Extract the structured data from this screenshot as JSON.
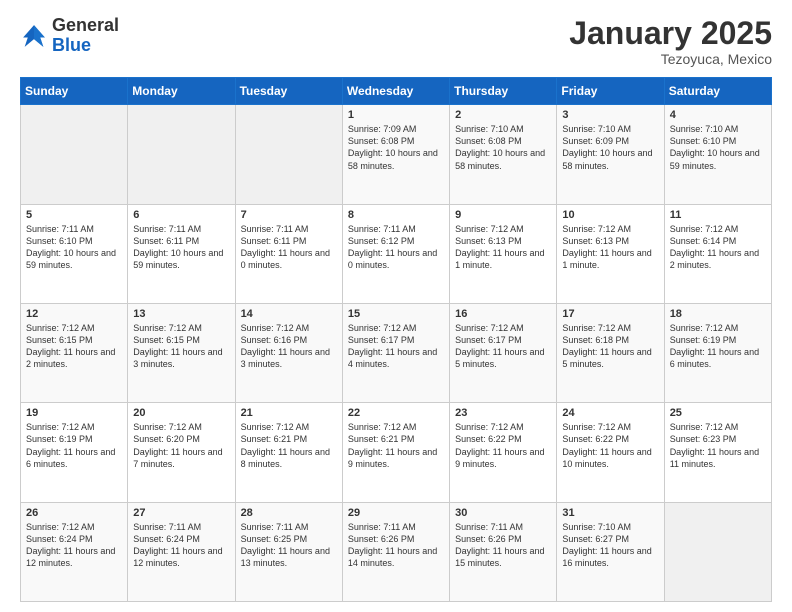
{
  "header": {
    "logo_general": "General",
    "logo_blue": "Blue",
    "month_title": "January 2025",
    "subtitle": "Tezoyuca, Mexico"
  },
  "days_of_week": [
    "Sunday",
    "Monday",
    "Tuesday",
    "Wednesday",
    "Thursday",
    "Friday",
    "Saturday"
  ],
  "weeks": [
    [
      {
        "day": "",
        "info": ""
      },
      {
        "day": "",
        "info": ""
      },
      {
        "day": "",
        "info": ""
      },
      {
        "day": "1",
        "info": "Sunrise: 7:09 AM\nSunset: 6:08 PM\nDaylight: 10 hours and 58 minutes."
      },
      {
        "day": "2",
        "info": "Sunrise: 7:10 AM\nSunset: 6:08 PM\nDaylight: 10 hours and 58 minutes."
      },
      {
        "day": "3",
        "info": "Sunrise: 7:10 AM\nSunset: 6:09 PM\nDaylight: 10 hours and 58 minutes."
      },
      {
        "day": "4",
        "info": "Sunrise: 7:10 AM\nSunset: 6:10 PM\nDaylight: 10 hours and 59 minutes."
      }
    ],
    [
      {
        "day": "5",
        "info": "Sunrise: 7:11 AM\nSunset: 6:10 PM\nDaylight: 10 hours and 59 minutes."
      },
      {
        "day": "6",
        "info": "Sunrise: 7:11 AM\nSunset: 6:11 PM\nDaylight: 10 hours and 59 minutes."
      },
      {
        "day": "7",
        "info": "Sunrise: 7:11 AM\nSunset: 6:11 PM\nDaylight: 11 hours and 0 minutes."
      },
      {
        "day": "8",
        "info": "Sunrise: 7:11 AM\nSunset: 6:12 PM\nDaylight: 11 hours and 0 minutes."
      },
      {
        "day": "9",
        "info": "Sunrise: 7:12 AM\nSunset: 6:13 PM\nDaylight: 11 hours and 1 minute."
      },
      {
        "day": "10",
        "info": "Sunrise: 7:12 AM\nSunset: 6:13 PM\nDaylight: 11 hours and 1 minute."
      },
      {
        "day": "11",
        "info": "Sunrise: 7:12 AM\nSunset: 6:14 PM\nDaylight: 11 hours and 2 minutes."
      }
    ],
    [
      {
        "day": "12",
        "info": "Sunrise: 7:12 AM\nSunset: 6:15 PM\nDaylight: 11 hours and 2 minutes."
      },
      {
        "day": "13",
        "info": "Sunrise: 7:12 AM\nSunset: 6:15 PM\nDaylight: 11 hours and 3 minutes."
      },
      {
        "day": "14",
        "info": "Sunrise: 7:12 AM\nSunset: 6:16 PM\nDaylight: 11 hours and 3 minutes."
      },
      {
        "day": "15",
        "info": "Sunrise: 7:12 AM\nSunset: 6:17 PM\nDaylight: 11 hours and 4 minutes."
      },
      {
        "day": "16",
        "info": "Sunrise: 7:12 AM\nSunset: 6:17 PM\nDaylight: 11 hours and 5 minutes."
      },
      {
        "day": "17",
        "info": "Sunrise: 7:12 AM\nSunset: 6:18 PM\nDaylight: 11 hours and 5 minutes."
      },
      {
        "day": "18",
        "info": "Sunrise: 7:12 AM\nSunset: 6:19 PM\nDaylight: 11 hours and 6 minutes."
      }
    ],
    [
      {
        "day": "19",
        "info": "Sunrise: 7:12 AM\nSunset: 6:19 PM\nDaylight: 11 hours and 6 minutes."
      },
      {
        "day": "20",
        "info": "Sunrise: 7:12 AM\nSunset: 6:20 PM\nDaylight: 11 hours and 7 minutes."
      },
      {
        "day": "21",
        "info": "Sunrise: 7:12 AM\nSunset: 6:21 PM\nDaylight: 11 hours and 8 minutes."
      },
      {
        "day": "22",
        "info": "Sunrise: 7:12 AM\nSunset: 6:21 PM\nDaylight: 11 hours and 9 minutes."
      },
      {
        "day": "23",
        "info": "Sunrise: 7:12 AM\nSunset: 6:22 PM\nDaylight: 11 hours and 9 minutes."
      },
      {
        "day": "24",
        "info": "Sunrise: 7:12 AM\nSunset: 6:22 PM\nDaylight: 11 hours and 10 minutes."
      },
      {
        "day": "25",
        "info": "Sunrise: 7:12 AM\nSunset: 6:23 PM\nDaylight: 11 hours and 11 minutes."
      }
    ],
    [
      {
        "day": "26",
        "info": "Sunrise: 7:12 AM\nSunset: 6:24 PM\nDaylight: 11 hours and 12 minutes."
      },
      {
        "day": "27",
        "info": "Sunrise: 7:11 AM\nSunset: 6:24 PM\nDaylight: 11 hours and 12 minutes."
      },
      {
        "day": "28",
        "info": "Sunrise: 7:11 AM\nSunset: 6:25 PM\nDaylight: 11 hours and 13 minutes."
      },
      {
        "day": "29",
        "info": "Sunrise: 7:11 AM\nSunset: 6:26 PM\nDaylight: 11 hours and 14 minutes."
      },
      {
        "day": "30",
        "info": "Sunrise: 7:11 AM\nSunset: 6:26 PM\nDaylight: 11 hours and 15 minutes."
      },
      {
        "day": "31",
        "info": "Sunrise: 7:10 AM\nSunset: 6:27 PM\nDaylight: 11 hours and 16 minutes."
      },
      {
        "day": "",
        "info": ""
      }
    ]
  ]
}
